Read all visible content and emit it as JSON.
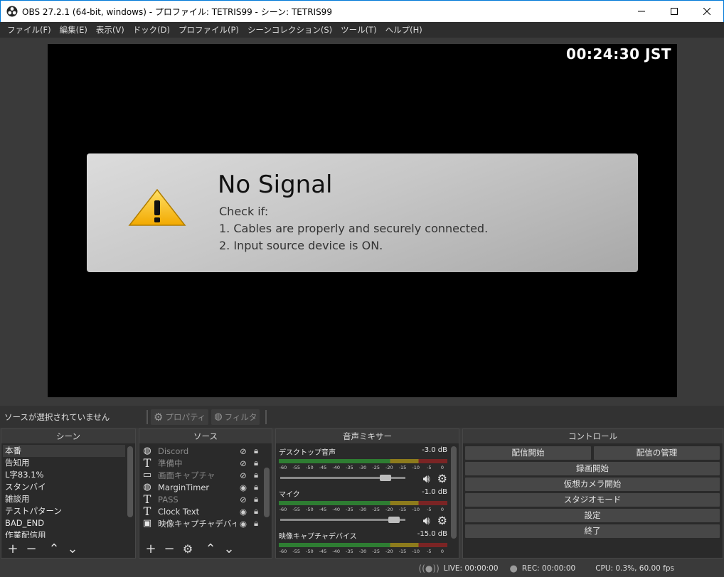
{
  "window": {
    "title": "OBS 27.2.1 (64-bit, windows) - プロファイル: TETRIS99 - シーン: TETRIS99",
    "minimize": "—",
    "maximize": "☐",
    "close": "✕"
  },
  "menu": [
    "ファイル(F)",
    "編集(E)",
    "表示(V)",
    "ドック(D)",
    "プロファイル(P)",
    "シーンコレクション(S)",
    "ツール(T)",
    "ヘルプ(H)"
  ],
  "preview": {
    "clock": "00:24:30 JST",
    "no_signal_title": "No Signal",
    "check_if": "Check if:",
    "line1": "1. Cables are properly and securely connected.",
    "line2": "2. Input source device is ON."
  },
  "source_toolbar": {
    "no_source": "ソースが選択されていません",
    "properties": "プロパティ",
    "filters": "フィルタ"
  },
  "scenes": {
    "header": "シーン",
    "items": [
      "本番",
      "告知用",
      "L字83.1%",
      "スタンバイ",
      "雑談用",
      "テストパターン",
      "BAD_END",
      "作業配信用"
    ]
  },
  "sources": {
    "header": "ソース",
    "items": [
      {
        "name": "Discord",
        "icon": "globe-icon",
        "visible": false
      },
      {
        "name": "準備中",
        "icon": "text-icon",
        "visible": false
      },
      {
        "name": "画面キャプチャ",
        "icon": "monitor-icon",
        "visible": false
      },
      {
        "name": "MarginTimer",
        "icon": "globe-icon",
        "visible": true
      },
      {
        "name": "PASS",
        "icon": "text-icon",
        "visible": false
      },
      {
        "name": "Clock Text",
        "icon": "text-icon",
        "visible": true
      },
      {
        "name": "映像キャプチャデバイス",
        "icon": "camera-icon",
        "visible": true
      }
    ]
  },
  "mixer": {
    "header": "音声ミキサー",
    "ticks": [
      "-60",
      "-55",
      "-50",
      "-45",
      "-40",
      "-35",
      "-30",
      "-25",
      "-20",
      "-15",
      "-10",
      "-5",
      "0"
    ],
    "channels": [
      {
        "name": "デスクトップ音声",
        "db": "-3.0 dB",
        "level": 0.95
      },
      {
        "name": "マイク",
        "db": "-1.0 dB",
        "level": 0.98
      },
      {
        "name": "映像キャプチャデバイス",
        "db": "-15.0 dB",
        "level": 0.75
      }
    ]
  },
  "controls": {
    "header": "コントロール",
    "start_stream": "配信開始",
    "manage_stream": "配信の管理",
    "start_recording": "録画開始",
    "start_virtualcam": "仮想カメラ開始",
    "studio_mode": "スタジオモード",
    "settings": "設定",
    "exit": "終了"
  },
  "status": {
    "live": "LIVE: 00:00:00",
    "rec": "REC: 00:00:00",
    "cpu": "CPU: 0.3%, 60.00 fps"
  }
}
